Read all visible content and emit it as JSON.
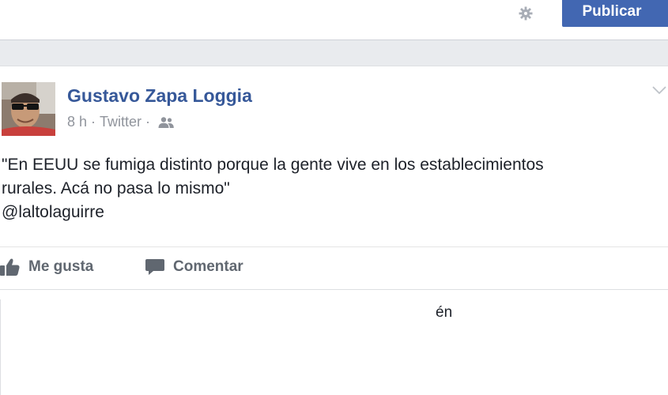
{
  "composer": {
    "publish_label": "Publicar",
    "settings_icon": "gear-icon"
  },
  "post": {
    "author": "Gustavo Zapa Loggia",
    "time": "8 h",
    "source": "Twitter",
    "audience_icon": "friends-icon",
    "text_lines": [
      "\"En EEUU se fumiga distinto porque la gente vive en los establecimientos",
      "rurales. Acá no pasa lo mismo\"",
      "@laltolaguirre"
    ],
    "options_icon": "chevron-down-icon"
  },
  "actions": {
    "like_label": "Me gusta",
    "comment_label": "Comentar"
  },
  "lower": {
    "fragment": "én"
  },
  "colors": {
    "publish_button": "#4267b2",
    "author_link": "#365899",
    "meta_text": "#90949c",
    "body_text": "#1d2129",
    "band": "#e9ebee"
  }
}
